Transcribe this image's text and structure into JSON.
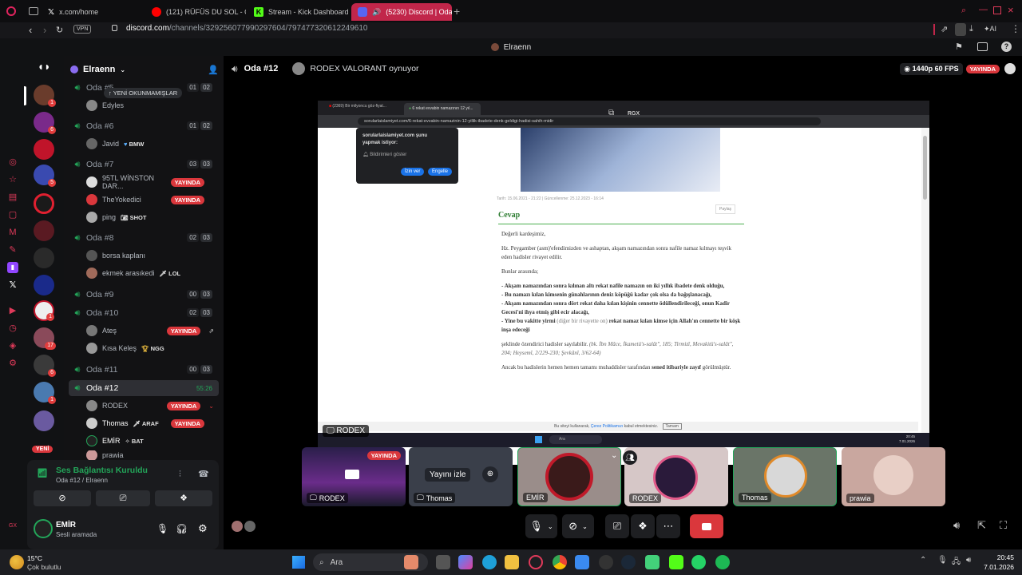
{
  "browser": {
    "tabs": [
      {
        "label": "x.com/home",
        "icon": "x-icon",
        "color": "#ffffff"
      },
      {
        "label": "(121) RÜFÜS DU SOL - On",
        "icon": "youtube-icon",
        "color": "#ff0000"
      },
      {
        "label": "Stream - Kick Dashboard",
        "icon": "kick-icon",
        "color": "#53fc18"
      },
      {
        "label": "(5230) Discord | Oda #",
        "icon": "discord-icon",
        "color": "#5865f2"
      }
    ],
    "vpn_label": "VPN",
    "url_host": "discord.com",
    "url_path": "/channels/329256077990297604/797477320612249610",
    "ai_label": "AI"
  },
  "app": {
    "title": "Elraenn",
    "accent": "#c1264a"
  },
  "guild_rail": {
    "badges": [
      "1",
      "6",
      "5",
      "1",
      "17",
      "6",
      "1"
    ],
    "new_label": "YENİ"
  },
  "channels": {
    "server_name": "Elraenn",
    "unread_pill": "YENİ OKUNMAMIŞLAR",
    "rows": [
      {
        "name": "Oda #5",
        "c1": "01",
        "c2": "02"
      },
      {
        "name": "Oda #6",
        "c1": "01",
        "c2": "02"
      },
      {
        "name": "Oda #7",
        "c1": "03",
        "c2": "03"
      },
      {
        "name": "Oda #8",
        "c1": "02",
        "c2": "03"
      },
      {
        "name": "Oda #9",
        "c1": "00",
        "c2": "03"
      },
      {
        "name": "Oda #10",
        "c1": "02",
        "c2": "03"
      },
      {
        "name": "Oda #11",
        "c1": "00",
        "c2": "03"
      },
      {
        "name": "Oda #12",
        "timer": "55:26"
      }
    ],
    "users": {
      "edyles": "Edyles",
      "javid": "Javid",
      "javid_tag": "BMW",
      "u95": "95TL WİNSTON DAR...",
      "theyokedici": "TheYokedici",
      "ping": "ping",
      "ping_tag": "SHOT",
      "borsa": "borsa kaplanı",
      "ekmek": "ekmek arasıkedi",
      "ekmek_tag": "LOL",
      "ates": "Ateş",
      "kisa": "Kısa Keleş",
      "kisa_tag": "NGG",
      "rodex": "RODEX",
      "thomas": "Thomas",
      "thomas_tag": "ARAF",
      "emir": "EMİR",
      "emir_tag": "BAT",
      "prawia": "prawia"
    },
    "live_label": "YAYINDA"
  },
  "voice": {
    "status": "Ses Bağlantısı Kuruldu",
    "channel": "Oda #12 / Elraenn",
    "user": "EMİR",
    "user_status": "Sesli aramada"
  },
  "stage": {
    "channel": "Oda #12",
    "activity": "RODEX VALORANT oynuyor",
    "quality": "1440p 60 FPS",
    "live": "YAYINDA",
    "streamer_tag": "RGX",
    "stream_owner": "RODEX"
  },
  "stream_content": {
    "tab1": "(2369) Bir milyoncu göz-fiyat...",
    "tab2": "6 rekat evvabin namazının 12 yıl...",
    "url": "sorularlaislamiyet.com/6-rekat-evvabin-namazinin-12-yillik-ibadete-denk-geldigi-hadisi-sahih-midir",
    "popup_title": "sorularlaislamiyet.com şunu yapmak istiyor:",
    "popup_item": "Bildirimleri göster",
    "popup_allow": "İzin ver",
    "popup_block": "Engelle",
    "date": "Tarih: 15.06.2021 - 21:22 | Güncellenme: 25.12.2023 - 16:14",
    "print": "Paylaş",
    "heading": "Cevap",
    "p1": "Değerli kardeşimiz,",
    "p2": "Hz. Peygamber (asm)'efendimizden ve ashaptan, akşam namazından sonra nafile namaz kılmayı teşvik eden hadisler rivayet edilir.",
    "p3": "Bunlar arasında;",
    "b1": "- Akşam namazından sonra kılınan altı rekat nafile namazın on iki yıllık ibadete denk olduğu,",
    "b2": "- Bu namazı kılan kimsenin günahlarının deniz köpüğü kadar çok olsa da bağışlanacağı,",
    "b3": "- Akşam namazından sonra dört rekat daha kılan kişinin cennette ödüllendirileceği, onun Kadir Gecesi'ni ihya etmiş gibi ecir alacağı,",
    "b4a": "- Yine bu vakitte yirmi",
    "b4b": "(diğer bir rivayette on)",
    "b4c": "rekat namaz kılan kimse için Allah'ın cennette bir köşk inşa edeceği",
    "p4a": "şeklinde özendirici hadisler sayılabilir.",
    "p4b": "(bk. İbn Mâce, İkametü's-salât\", 185; Tirmizî, Mevakitü's-salât\", 204; Heysemî, 2/229-230; Şevkânî, 3/62-64)",
    "p5a": "Ancak bu hadislerin hemen hemen tamamı muhaddisler tarafından",
    "p5b": "sened itibariyle zayıf",
    "p5c": "görülmüştür.",
    "cookie": "Bu siteyi kullanarak,",
    "cookie_link": "Çerez Politikamızı",
    "cookie_tail": "kabul etmektesiniz.",
    "cookie_btn": "Tamam",
    "search_label": "Ara",
    "clock_time": "20:45",
    "clock_date": "7.01.2026"
  },
  "tiles": [
    {
      "name": "RODEX",
      "live": "YAYINDA"
    },
    {
      "name": "Thomas",
      "watch": "Yayını izle"
    },
    {
      "name": "EMİR"
    },
    {
      "name": "RODEX"
    },
    {
      "name": "Thomas"
    },
    {
      "name": "prawia"
    }
  ],
  "taskbar": {
    "temp": "15°C",
    "weather": "Çok bulutlu",
    "search": "Ara",
    "time": "20:45",
    "date": "7.01.2026"
  }
}
